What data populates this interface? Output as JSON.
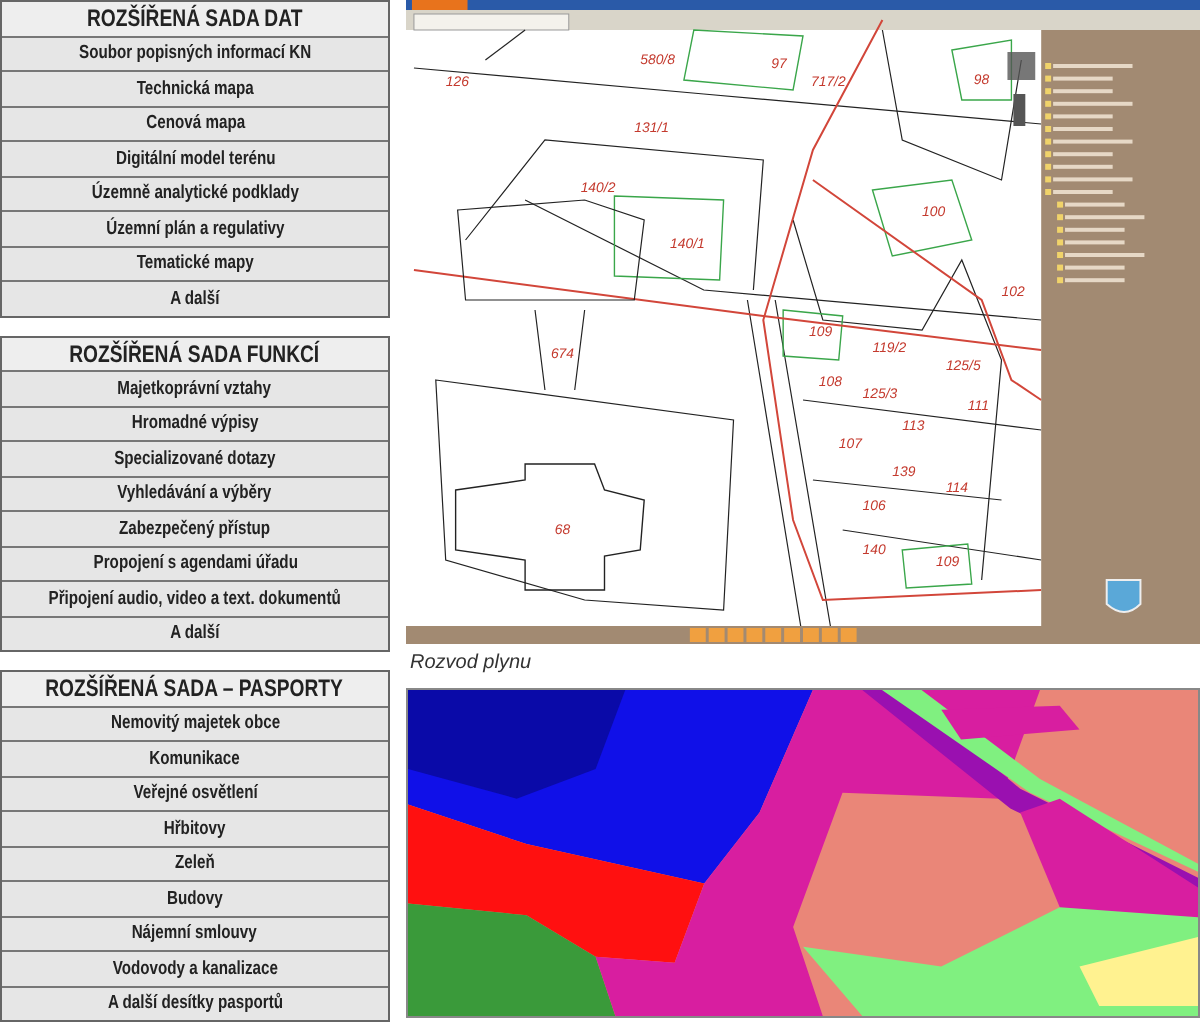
{
  "sections": [
    {
      "title": "ROZŠÍŘENÁ SADA DAT",
      "items": [
        "Soubor popisných informací KN",
        "Technická mapa",
        "Cenová mapa",
        "Digitální model terénu",
        "Územně analytické podklady",
        "Územní plán a regulativy",
        "Tematické mapy",
        "A další"
      ]
    },
    {
      "title": "ROZŠÍŘENÁ SADA FUNKCÍ",
      "items": [
        "Majetkoprávní vztahy",
        "Hromadné výpisy",
        "Specializované dotazy",
        "Vyhledávání a výběry",
        "Zabezpečený přístup",
        "Propojení s agendami úřadu",
        "Připojení audio, video a text. dokumentů",
        "A další"
      ]
    },
    {
      "title": "ROZŠÍŘENÁ SADA – PASPORTY",
      "items": [
        "Nemovitý majetek obce",
        "Komunikace",
        "Veřejné osvětlení",
        "Hřbitovy",
        "Zeleň",
        "Budovy",
        "Nájemní smlouvy",
        "Vodovody a kanalizace",
        "A další desítky pasportů"
      ]
    }
  ],
  "map_app": {
    "parcels": [
      "126",
      "580/8",
      "97",
      "717/2",
      "98",
      "131/1",
      "140/2",
      "140/1",
      "100",
      "102",
      "109",
      "119/2",
      "125/5",
      "111",
      "674",
      "108",
      "125/3",
      "113",
      "107",
      "139",
      "114",
      "106",
      "68",
      "140",
      "109"
    ],
    "caption": "Rozvod plynu"
  }
}
